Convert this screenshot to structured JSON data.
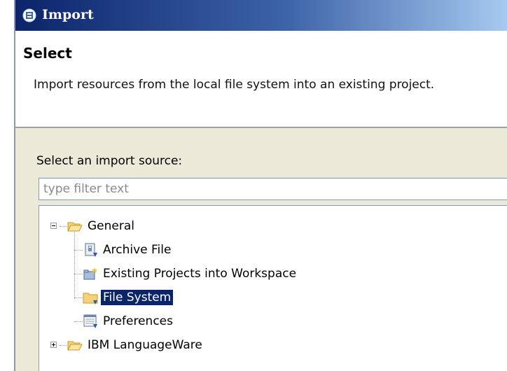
{
  "window": {
    "title": "Import",
    "icon": "import-wizard-icon"
  },
  "header": {
    "title": "Select",
    "description": "Import resources from the local file system into an existing project."
  },
  "source": {
    "label": "Select an import source:",
    "filter_placeholder": "type filter text",
    "filter_value": ""
  },
  "tree": {
    "items": [
      {
        "label": "General",
        "icon": "folder-open-icon",
        "expanded": true
      },
      {
        "label": "Archive File",
        "icon": "archive-file-icon"
      },
      {
        "label": "Existing Projects into Workspace",
        "icon": "existing-projects-icon"
      },
      {
        "label": "File System",
        "icon": "folder-icon",
        "selected": true
      },
      {
        "label": "Preferences",
        "icon": "preferences-icon"
      },
      {
        "label": "IBM LanguageWare",
        "icon": "folder-open-icon",
        "expanded": false
      }
    ]
  },
  "colors": {
    "selection": "#0a246a",
    "titlebar_start": "#0b246a",
    "titlebar_end": "#a6caf0"
  }
}
